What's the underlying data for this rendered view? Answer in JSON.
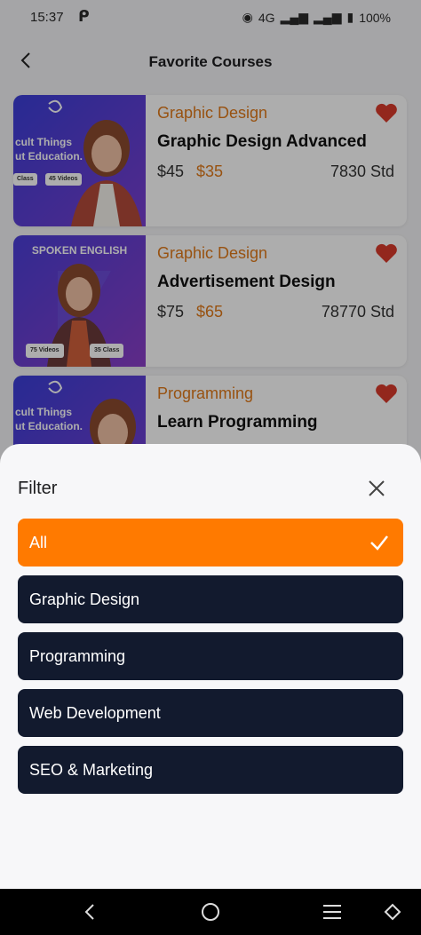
{
  "status_bar": {
    "time": "15:37",
    "network": "4G",
    "battery": "100%"
  },
  "header": {
    "title": "Favorite Courses"
  },
  "courses": [
    {
      "category": "Graphic Design",
      "title": "Graphic Design Advanced",
      "price": "$45",
      "sale_price": "$35",
      "students": "7830 Std",
      "thumb_line1": "cult Things",
      "thumb_line2": "ut Education.",
      "badge_a": "Class",
      "badge_b": "45 Videos"
    },
    {
      "category": "Graphic Design",
      "title": "Advertisement Design",
      "price": "$75",
      "sale_price": "$65",
      "students": "78770 Std",
      "thumb_line1": "SPOKEN ENGLISH",
      "badge_a": "75 Videos",
      "badge_b": "35 Class"
    },
    {
      "category": "Programming",
      "title": "Learn Programming",
      "price": "",
      "sale_price": "",
      "students": "",
      "thumb_line1": "cult Things",
      "thumb_line2": "ut Education."
    }
  ],
  "filter": {
    "title": "Filter",
    "options": [
      {
        "label": "All",
        "selected": true
      },
      {
        "label": "Graphic Design",
        "selected": false
      },
      {
        "label": "Programming",
        "selected": false
      },
      {
        "label": "Web Development",
        "selected": false
      },
      {
        "label": "SEO & Marketing",
        "selected": false
      }
    ]
  },
  "colors": {
    "accent": "#ff7a00",
    "category_text": "#e07a1a",
    "option_bg": "#121a2e",
    "heart": "#d93a2b"
  }
}
